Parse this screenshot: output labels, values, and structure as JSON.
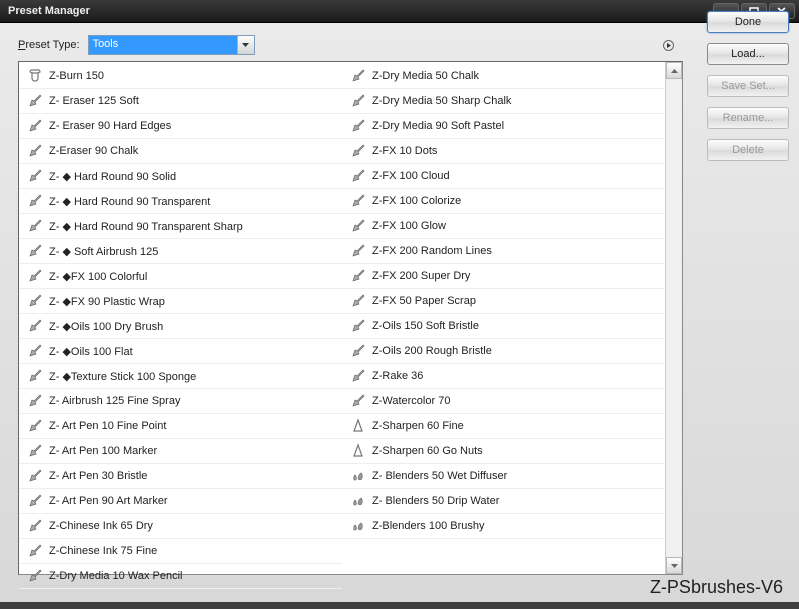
{
  "window": {
    "title": "Preset Manager"
  },
  "topbar": {
    "label": "Preset Type:",
    "combo_value": "Tools"
  },
  "buttons": {
    "done": "Done",
    "load": "Load...",
    "save": "Save Set...",
    "rename": "Rename...",
    "delete": "Delete"
  },
  "presets_col1": [
    "Z-Burn 150",
    "Z- Eraser 125 Soft",
    "Z- Eraser 90 Hard Edges",
    "Z-Eraser 90 Chalk",
    "Z- ◆ Hard Round 90 Solid",
    "Z- ◆ Hard Round 90 Transparent",
    "Z- ◆ Hard Round 90 Transparent Sharp",
    "Z- ◆ Soft Airbrush 125",
    "Z- ◆FX 100 Colorful",
    "Z- ◆FX 90 Plastic Wrap",
    "Z- ◆Oils 100 Dry Brush",
    "Z- ◆Oils 100 Flat",
    "Z- ◆Texture Stick 100 Sponge",
    "Z- Airbrush 125 Fine Spray",
    "Z- Art Pen 10 Fine Point",
    "Z- Art Pen 100 Marker",
    "Z- Art Pen 30 Bristle",
    "Z- Art Pen 90 Art Marker",
    "Z-Chinese Ink 65 Dry",
    "Z-Chinese Ink 75 Fine",
    "Z-Dry Media 10 Wax Pencil"
  ],
  "presets_col2": [
    "Z-Dry Media 50 Chalk",
    "Z-Dry Media 50 Sharp Chalk",
    "Z-Dry Media 90 Soft Pastel",
    "Z-FX 10 Dots",
    "Z-FX 100 Cloud",
    "Z-FX 100 Colorize",
    "Z-FX 100 Glow",
    "Z-FX 200 Random Lines",
    "Z-FX 200 Super Dry",
    "Z-FX 50 Paper Scrap",
    "Z-Oils 150 Soft Bristle",
    "Z-Oils 200 Rough Bristle",
    "Z-Rake 36",
    "Z-Watercolor 70",
    "Z-Sharpen 60 Fine",
    "Z-Sharpen 60 Go Nuts",
    "Z-  Blenders 50 Wet Diffuser",
    "Z- Blenders 50 Drip Water",
    "Z-Blenders 100 Brushy"
  ],
  "icons_col1": [
    "burn",
    "brush",
    "brush",
    "brush",
    "brush",
    "brush",
    "brush",
    "brush",
    "brush",
    "brush",
    "brush",
    "brush",
    "brush",
    "brush",
    "brush",
    "brush",
    "brush",
    "brush",
    "brush",
    "brush",
    "brush"
  ],
  "icons_col2": [
    "brush",
    "brush",
    "brush",
    "brush",
    "brush",
    "brush",
    "brush",
    "brush",
    "brush",
    "brush",
    "brush",
    "brush",
    "brush",
    "brush",
    "sharpen",
    "sharpen",
    "smudge",
    "smudge",
    "smudge"
  ],
  "watermark": "Z-PSbrushes-V6"
}
